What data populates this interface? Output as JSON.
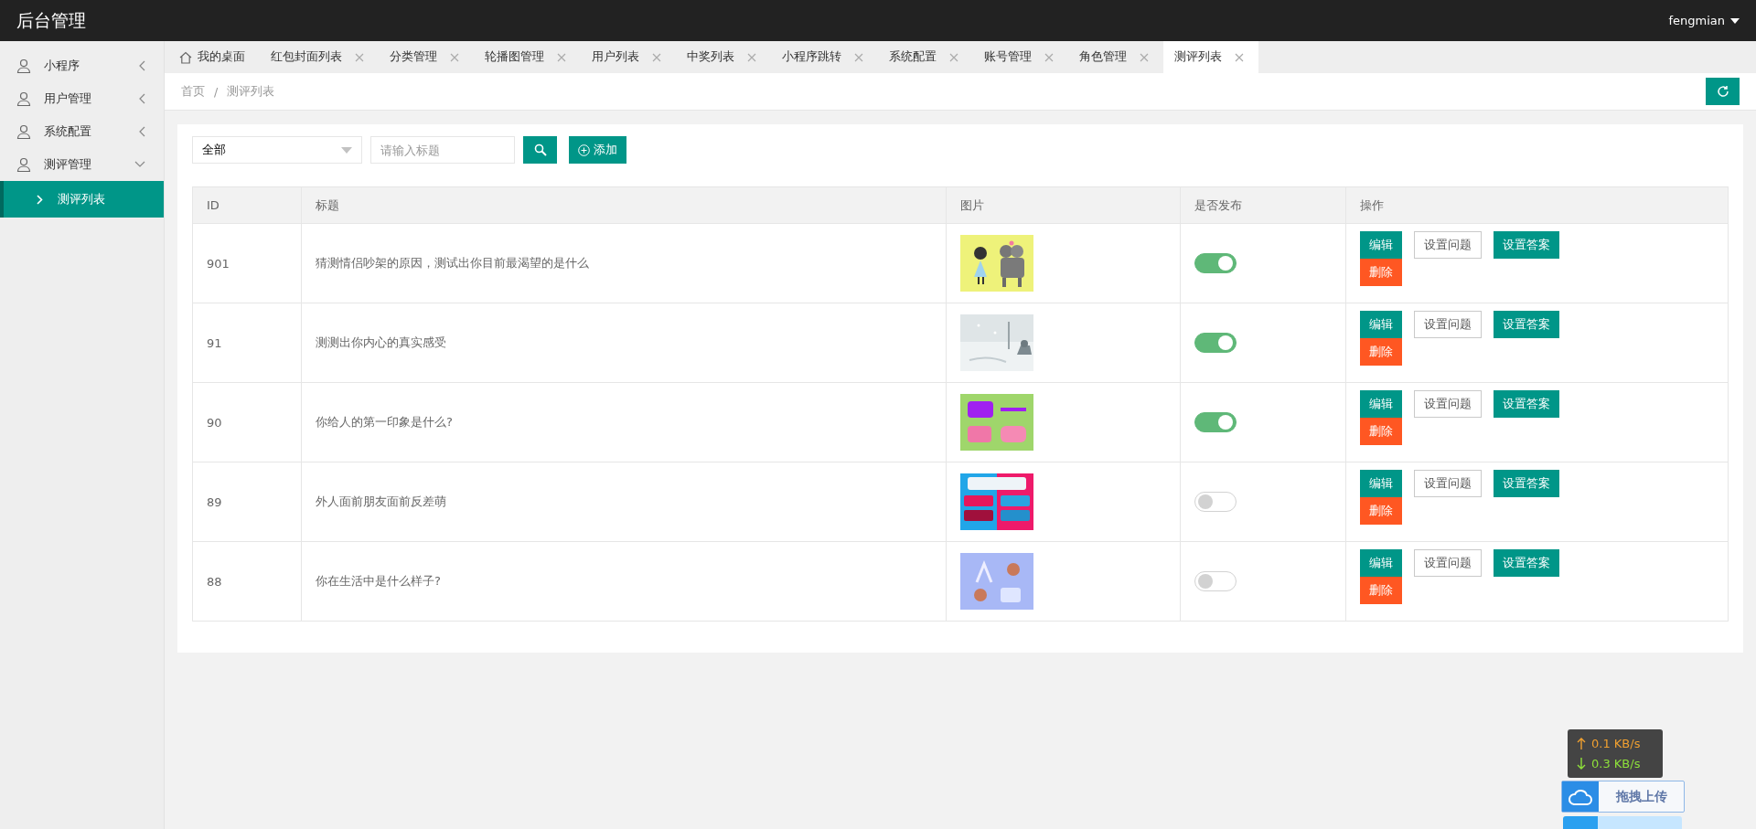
{
  "header": {
    "title": "后台管理",
    "user": "fengmian"
  },
  "sidebar": {
    "items": [
      {
        "label": "小程序",
        "expanded": false
      },
      {
        "label": "用户管理",
        "expanded": false
      },
      {
        "label": "系统配置",
        "expanded": false
      },
      {
        "label": "测评管理",
        "expanded": true,
        "children": [
          {
            "label": "测评列表",
            "selected": true
          }
        ]
      }
    ]
  },
  "tabs": [
    {
      "label": "我的桌面",
      "kind": "home",
      "selected": false
    },
    {
      "label": "红包封面列表",
      "kind": "page",
      "selected": false
    },
    {
      "label": "分类管理",
      "kind": "page",
      "selected": false
    },
    {
      "label": "轮播图管理",
      "kind": "page",
      "selected": false
    },
    {
      "label": "用户列表",
      "kind": "page",
      "selected": false
    },
    {
      "label": "中奖列表",
      "kind": "page",
      "selected": false
    },
    {
      "label": "小程序跳转",
      "kind": "page",
      "selected": false
    },
    {
      "label": "系统配置",
      "kind": "page",
      "selected": false
    },
    {
      "label": "账号管理",
      "kind": "page",
      "selected": false
    },
    {
      "label": "角色管理",
      "kind": "page",
      "selected": false
    },
    {
      "label": "测评列表",
      "kind": "page",
      "selected": true
    }
  ],
  "breadcrumb": {
    "items": [
      "首页",
      "测评列表"
    ],
    "separator": "/"
  },
  "filter": {
    "select": "全部",
    "placeholder": "请输入标题",
    "add_label": "添加"
  },
  "table": {
    "columns": [
      "ID",
      "标题",
      "图片",
      "是否发布",
      "操作"
    ],
    "rows": [
      {
        "id": "901",
        "title": "猜测情侣吵架的原因，测试出你目前最渴望的是什么",
        "image": {
          "kind": "picture"
        },
        "published": true,
        "action_lines": [
          [
            {
              "label": "编辑",
              "kind": "primary"
            },
            {
              "label": "设置问题",
              "kind": "outline"
            },
            {
              "label": "设置答案",
              "kind": "primary"
            }
          ],
          [
            {
              "label": "删除",
              "kind": "danger"
            }
          ]
        ]
      },
      {
        "id": "91",
        "title": "测测出你内心的真实感受",
        "image": {
          "kind": "picture"
        },
        "published": true,
        "action_lines": [
          [
            {
              "label": "编辑",
              "kind": "primary"
            },
            {
              "label": "设置问题",
              "kind": "outline"
            },
            {
              "label": "设置答案",
              "kind": "primary"
            }
          ],
          [
            {
              "label": "删除",
              "kind": "danger"
            }
          ]
        ]
      },
      {
        "id": "90",
        "title": "你给人的第一印象是什么?",
        "image": {
          "kind": "picture"
        },
        "published": true,
        "action_lines": [
          [
            {
              "label": "编辑",
              "kind": "primary"
            },
            {
              "label": "设置问题",
              "kind": "outline"
            },
            {
              "label": "设置答案",
              "kind": "primary"
            }
          ],
          [
            {
              "label": "删除",
              "kind": "danger"
            }
          ]
        ]
      },
      {
        "id": "89",
        "title": "外人面前朋友面前反差萌",
        "image": {
          "kind": "picture"
        },
        "published": false,
        "action_lines": [
          [
            {
              "label": "编辑",
              "kind": "primary"
            },
            {
              "label": "设置问题",
              "kind": "outline"
            },
            {
              "label": "设置答案",
              "kind": "primary"
            }
          ],
          [
            {
              "label": "删除",
              "kind": "danger"
            }
          ]
        ]
      },
      {
        "id": "88",
        "title": "你在生活中是什么样子?",
        "image": {
          "kind": "picture"
        },
        "published": false,
        "action_lines": [
          [
            {
              "label": "编辑",
              "kind": "primary"
            },
            {
              "label": "设置问题",
              "kind": "outline"
            },
            {
              "label": "设置答案",
              "kind": "primary"
            }
          ],
          [
            {
              "label": "删除",
              "kind": "danger"
            }
          ]
        ]
      }
    ]
  },
  "speed": {
    "up": "0.1 KB/s",
    "down": "0.3 KB/s"
  },
  "upload": {
    "label": "拖拽上传"
  }
}
